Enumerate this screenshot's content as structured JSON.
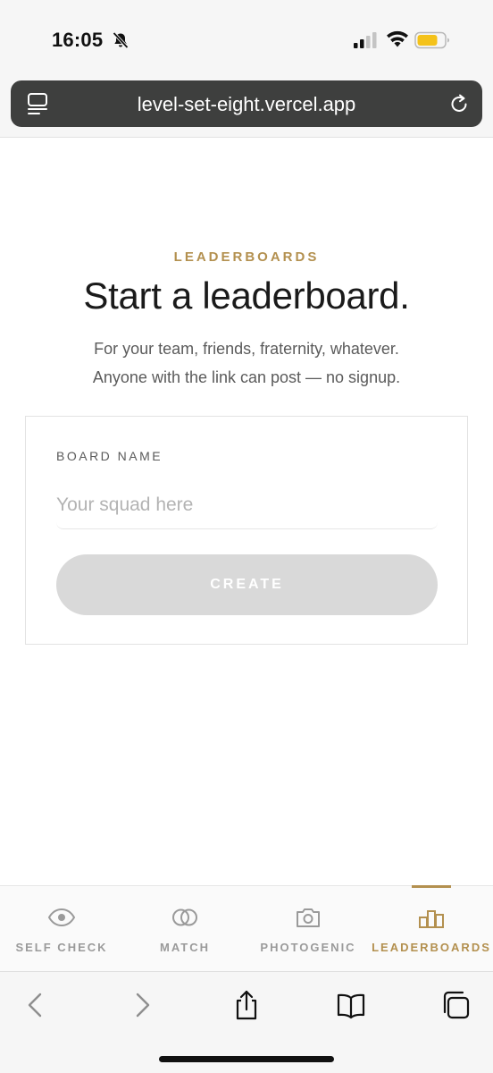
{
  "status_bar": {
    "time": "16:05",
    "icons": [
      "bell-slash-icon",
      "cellular-signal-icon",
      "wifi-icon",
      "battery-icon"
    ],
    "battery_color": "#f4c21a"
  },
  "browser": {
    "url": "level-set-eight.vercel.app",
    "url_bar_color": "#3e3f3e"
  },
  "page": {
    "eyebrow": "LEADERBOARDS",
    "title": "Start a leaderboard.",
    "subtitle_line1": "For your team, friends, fraternity, whatever.",
    "subtitle_line2": "Anyone with the link can post — no signup.",
    "accent_color": "#b3904f"
  },
  "form": {
    "board_name_label": "BOARD NAME",
    "board_name_value": "",
    "board_name_placeholder": "Your squad here",
    "create_label": "CREATE",
    "create_disabled": true
  },
  "tabs": [
    {
      "label": "SELF CHECK",
      "icon": "eye-icon",
      "active": false
    },
    {
      "label": "MATCH",
      "icon": "overlapping-rings-icon",
      "active": false
    },
    {
      "label": "PHOTOGENIC",
      "icon": "camera-icon",
      "active": false
    },
    {
      "label": "LEADERBOARDS",
      "icon": "bar-chart-icon",
      "active": true
    }
  ],
  "browser_toolbar": {
    "icons": [
      "back-icon",
      "forward-icon",
      "share-icon",
      "bookmarks-icon",
      "tabs-icon"
    ]
  }
}
